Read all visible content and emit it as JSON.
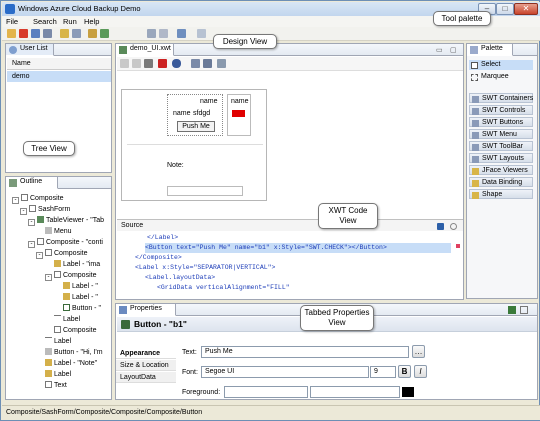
{
  "window": {
    "title": "Windows Azure Cloud Backup Demo"
  },
  "menu": [
    "File",
    "Search",
    "Run",
    "Help"
  ],
  "user_list": {
    "tab": "User List",
    "column": "Name",
    "rows": [
      "demo"
    ]
  },
  "editor": {
    "tab": "demo_UI.xwt",
    "form": {
      "name_label": "name",
      "name_label2": "name",
      "name_value": "sfdgd",
      "button": "Push Me",
      "right_label": "name",
      "note_label": "Note:"
    }
  },
  "palette": {
    "tab": "Palette",
    "tools": [
      "Select",
      "Marquee"
    ],
    "categories": [
      "SWT Containers",
      "SWT Controls",
      "SWT Buttons",
      "SWT Menu",
      "SWT ToolBar",
      "SWT Layouts",
      "JFace Viewers",
      "Data Binding",
      "Shape"
    ]
  },
  "outline": {
    "tab": "Outline",
    "items": [
      "Composite",
      "SashForm",
      "TableViewer - \"Tab",
      "Menu",
      "Composite - \"conti",
      "Composite",
      "Label - \"ima",
      "Composite",
      "Label - \"",
      "Label - \"",
      "Button - \"",
      "Label",
      "Composite",
      "Label",
      "Button - \"Hi, I'm",
      "Label - \"Note\"",
      "Label",
      "Text"
    ]
  },
  "source": {
    "tab": "Source",
    "lines": [
      "</Label>",
      "<Button text=\"Push Me\" name=\"b1\" x:Style=\"SWT.CHECK\"></Button>",
      "</Composite>",
      "<Label x:Style=\"SEPARATOR|VERTICAL\">",
      "<Label.layoutData>",
      "<GridData verticalAlignment=\"FILL\""
    ]
  },
  "properties": {
    "tab": "Properties",
    "title": "Button - \"b1\"",
    "sections": [
      "Appearance",
      "Size & Location",
      "LayoutData"
    ],
    "text_label": "Text:",
    "text_value": "Push Me",
    "font_label": "Font:",
    "font_value": "Segoe UI",
    "font_size": "9",
    "bold": "B",
    "italic": "I",
    "foreground_label": "Foreground:"
  },
  "status_bar": {
    "path": "Composite/SashForm/Composite/Composite/Composite/Button"
  },
  "callouts": {
    "design_view": "Design View",
    "tool_palette": "Tool palette",
    "tree_view": "Tree View",
    "xwt_code_view": "XWT Code View",
    "tabbed_properties_view": "Tabbed Properties View"
  },
  "colors": {
    "selection": "#c7ddf7",
    "swatch_red": "#e00000",
    "tag_blue": "#1c3cb8",
    "attr_purple": "#7a2090",
    "string_blue": "#2030c0"
  }
}
